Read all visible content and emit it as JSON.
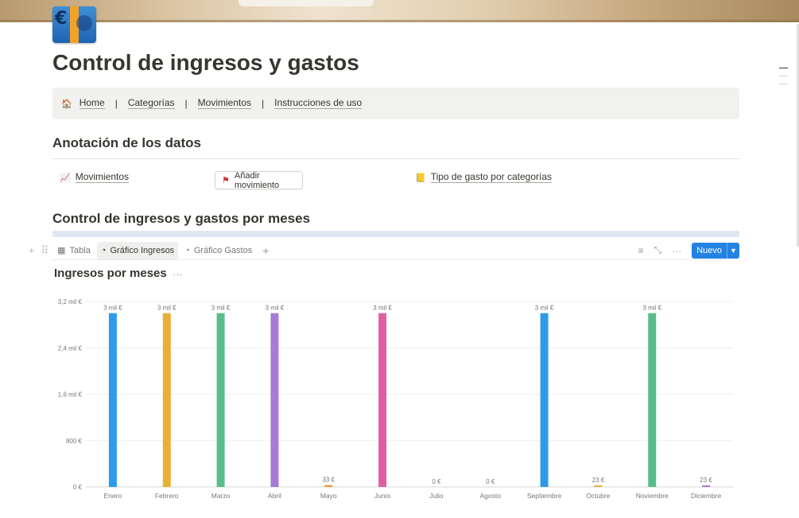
{
  "page": {
    "title": "Control de ingresos y gastos",
    "icon": "euro-banknote-icon"
  },
  "nav": {
    "items": [
      {
        "label": "Home",
        "icon": "house-icon"
      },
      {
        "label": "Categorías"
      },
      {
        "label": "Movimientos"
      },
      {
        "label": "Instrucciones de uso"
      }
    ],
    "separator": "|"
  },
  "anotacion": {
    "heading": "Anotación de los datos",
    "movimientos_link": "Movimientos",
    "add_button": "Añadir movimiento",
    "tipo_gasto_link": "Tipo de gasto por categorías"
  },
  "section": {
    "heading": "Control de ingresos y gastos por meses"
  },
  "views": {
    "tabs": [
      {
        "label": "Tabla",
        "icon": "table-icon",
        "active": false
      },
      {
        "label": "Gráfico Ingresos",
        "icon": "chart-icon",
        "active": true
      },
      {
        "label": "Gráfico Gastos",
        "icon": "chart-icon",
        "active": false
      }
    ],
    "new_button": "Nuevo",
    "accent_color": "#2383e2"
  },
  "chart_title": "Ingresos por meses",
  "chart_data": {
    "type": "bar",
    "title": "Ingresos por meses",
    "categories": [
      "Enero",
      "Febrero",
      "Marzo",
      "Abril",
      "Mayo",
      "Junio",
      "Julio",
      "Agosto",
      "Septiembre",
      "Octubre",
      "Noviembre",
      "Diciembre"
    ],
    "values": [
      3000,
      3000,
      3000,
      3000,
      33,
      3000,
      0,
      0,
      3000,
      23,
      3000,
      23
    ],
    "data_labels": [
      "3 mil €",
      "3 mil €",
      "3 mil €",
      "3 mil €",
      "33 €",
      "3 mil €",
      "0 €",
      "0 €",
      "3 mil €",
      "23 €",
      "3 mil €",
      "23 €"
    ],
    "colors": [
      "#2e9bea",
      "#e8b136",
      "#59bd8b",
      "#a77ad6",
      "#ef9a3d",
      "#df5fa4",
      "#9b9a97",
      "#9b9a97",
      "#2e9bea",
      "#e8b136",
      "#59bd8b",
      "#a77ad6"
    ],
    "yticks": [
      0,
      800,
      1600,
      2400,
      3200
    ],
    "ytick_labels": [
      "0 €",
      "800 €",
      "1,6 mil €",
      "2,4 mil €",
      "3,2 mil €"
    ],
    "ylim": [
      0,
      3200
    ],
    "grid": true
  }
}
